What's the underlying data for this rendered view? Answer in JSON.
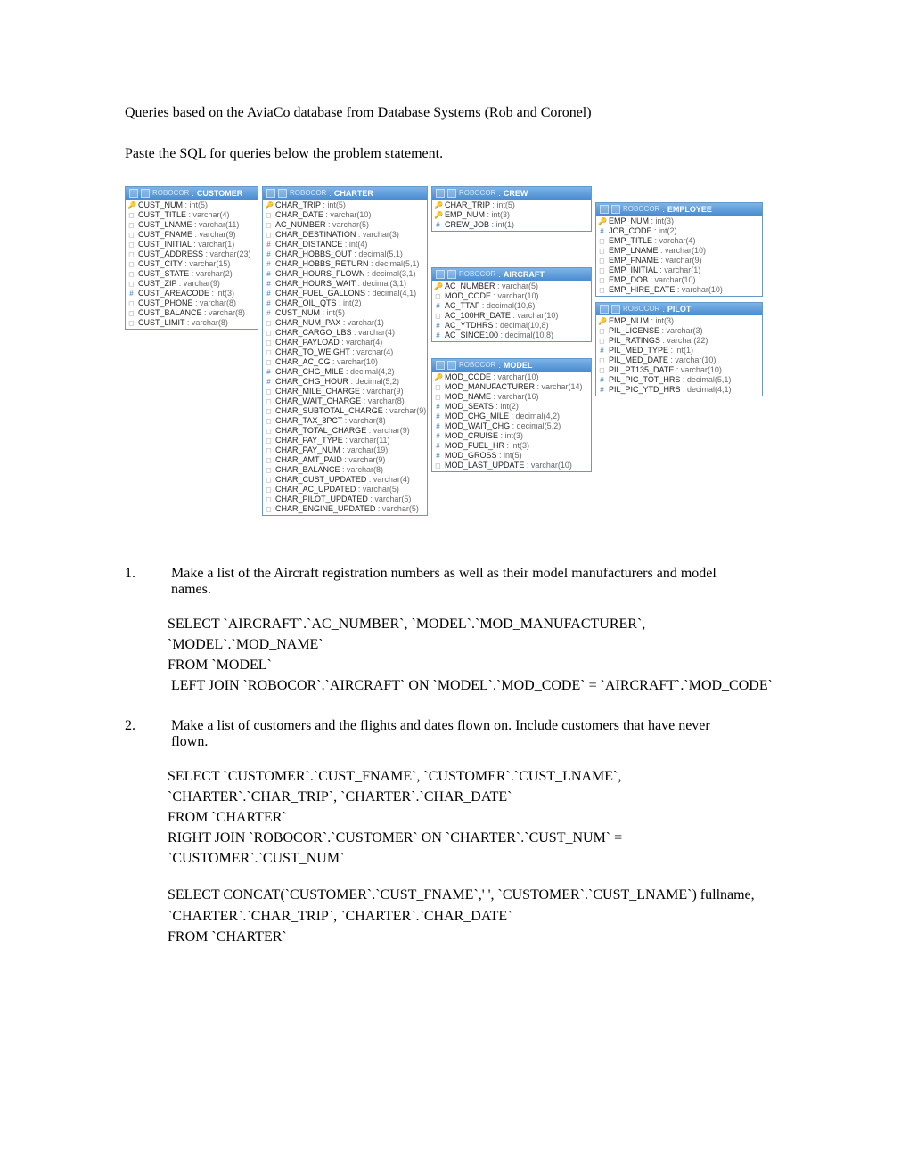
{
  "intro_line1": "Queries based on the AviaCo database from Database Systems (Rob and Coronel)",
  "intro_line2": "Paste the SQL for queries below the problem statement.",
  "schema": "ROBOCOR",
  "tables": {
    "customer": {
      "name": "CUSTOMER",
      "fields": [
        {
          "ic": "pk",
          "name": "CUST_NUM",
          "type": "int(5)"
        },
        {
          "ic": "col",
          "name": "CUST_TITLE",
          "type": "varchar(4)"
        },
        {
          "ic": "col",
          "name": "CUST_LNAME",
          "type": "varchar(11)"
        },
        {
          "ic": "col",
          "name": "CUST_FNAME",
          "type": "varchar(9)"
        },
        {
          "ic": "col",
          "name": "CUST_INITIAL",
          "type": "varchar(1)"
        },
        {
          "ic": "col",
          "name": "CUST_ADDRESS",
          "type": "varchar(23)"
        },
        {
          "ic": "col",
          "name": "CUST_CITY",
          "type": "varchar(15)"
        },
        {
          "ic": "col",
          "name": "CUST_STATE",
          "type": "varchar(2)"
        },
        {
          "ic": "col",
          "name": "CUST_ZIP",
          "type": "varchar(9)"
        },
        {
          "ic": "num",
          "name": "CUST_AREACODE",
          "type": "int(3)"
        },
        {
          "ic": "col",
          "name": "CUST_PHONE",
          "type": "varchar(8)"
        },
        {
          "ic": "col",
          "name": "CUST_BALANCE",
          "type": "varchar(8)"
        },
        {
          "ic": "col",
          "name": "CUST_LIMIT",
          "type": "varchar(8)"
        }
      ]
    },
    "charter": {
      "name": "CHARTER",
      "fields": [
        {
          "ic": "pk",
          "name": "CHAR_TRIP",
          "type": "int(5)"
        },
        {
          "ic": "col",
          "name": "CHAR_DATE",
          "type": "varchar(10)"
        },
        {
          "ic": "col",
          "name": "AC_NUMBER",
          "type": "varchar(5)"
        },
        {
          "ic": "col",
          "name": "CHAR_DESTINATION",
          "type": "varchar(3)"
        },
        {
          "ic": "num",
          "name": "CHAR_DISTANCE",
          "type": "int(4)"
        },
        {
          "ic": "num",
          "name": "CHAR_HOBBS_OUT",
          "type": "decimal(5,1)"
        },
        {
          "ic": "num",
          "name": "CHAR_HOBBS_RETURN",
          "type": "decimal(5,1)"
        },
        {
          "ic": "num",
          "name": "CHAR_HOURS_FLOWN",
          "type": "decimal(3,1)"
        },
        {
          "ic": "num",
          "name": "CHAR_HOURS_WAIT",
          "type": "decimal(3,1)"
        },
        {
          "ic": "num",
          "name": "CHAR_FUEL_GALLONS",
          "type": "decimal(4,1)"
        },
        {
          "ic": "num",
          "name": "CHAR_OIL_QTS",
          "type": "int(2)"
        },
        {
          "ic": "num",
          "name": "CUST_NUM",
          "type": "int(5)"
        },
        {
          "ic": "col",
          "name": "CHAR_NUM_PAX",
          "type": "varchar(1)"
        },
        {
          "ic": "col",
          "name": "CHAR_CARGO_LBS",
          "type": "varchar(4)"
        },
        {
          "ic": "col",
          "name": "CHAR_PAYLOAD",
          "type": "varchar(4)"
        },
        {
          "ic": "col",
          "name": "CHAR_TO_WEIGHT",
          "type": "varchar(4)"
        },
        {
          "ic": "col",
          "name": "CHAR_AC_CG",
          "type": "varchar(10)"
        },
        {
          "ic": "num",
          "name": "CHAR_CHG_MILE",
          "type": "decimal(4,2)"
        },
        {
          "ic": "num",
          "name": "CHAR_CHG_HOUR",
          "type": "decimal(5,2)"
        },
        {
          "ic": "col",
          "name": "CHAR_MILE_CHARGE",
          "type": "varchar(9)"
        },
        {
          "ic": "col",
          "name": "CHAR_WAIT_CHARGE",
          "type": "varchar(8)"
        },
        {
          "ic": "col",
          "name": "CHAR_SUBTOTAL_CHARGE",
          "type": "varchar(9)"
        },
        {
          "ic": "col",
          "name": "CHAR_TAX_8PCT",
          "type": "varchar(8)"
        },
        {
          "ic": "col",
          "name": "CHAR_TOTAL_CHARGE",
          "type": "varchar(9)"
        },
        {
          "ic": "col",
          "name": "CHAR_PAY_TYPE",
          "type": "varchar(11)"
        },
        {
          "ic": "col",
          "name": "CHAR_PAY_NUM",
          "type": "varchar(19)"
        },
        {
          "ic": "col",
          "name": "CHAR_AMT_PAID",
          "type": "varchar(9)"
        },
        {
          "ic": "col",
          "name": "CHAR_BALANCE",
          "type": "varchar(8)"
        },
        {
          "ic": "col",
          "name": "CHAR_CUST_UPDATED",
          "type": "varchar(4)"
        },
        {
          "ic": "col",
          "name": "CHAR_AC_UPDATED",
          "type": "varchar(5)"
        },
        {
          "ic": "col",
          "name": "CHAR_PILOT_UPDATED",
          "type": "varchar(5)"
        },
        {
          "ic": "col",
          "name": "CHAR_ENGINE_UPDATED",
          "type": "varchar(5)"
        }
      ]
    },
    "crew": {
      "name": "CREW",
      "fields": [
        {
          "ic": "pk",
          "name": "CHAR_TRIP",
          "type": "int(5)"
        },
        {
          "ic": "pk",
          "name": "EMP_NUM",
          "type": "int(3)"
        },
        {
          "ic": "num",
          "name": "CREW_JOB",
          "type": "int(1)"
        }
      ]
    },
    "aircraft": {
      "name": "AIRCRAFT",
      "fields": [
        {
          "ic": "pk",
          "name": "AC_NUMBER",
          "type": "varchar(5)"
        },
        {
          "ic": "col",
          "name": "MOD_CODE",
          "type": "varchar(10)"
        },
        {
          "ic": "num",
          "name": "AC_TTAF",
          "type": "decimal(10,6)"
        },
        {
          "ic": "col",
          "name": "AC_100HR_DATE",
          "type": "varchar(10)"
        },
        {
          "ic": "num",
          "name": "AC_YTDHRS",
          "type": "decimal(10,8)"
        },
        {
          "ic": "num",
          "name": "AC_SINCE100",
          "type": "decimal(10,8)"
        }
      ]
    },
    "model": {
      "name": "MODEL",
      "fields": [
        {
          "ic": "pk",
          "name": "MOD_CODE",
          "type": "varchar(10)"
        },
        {
          "ic": "col",
          "name": "MOD_MANUFACTURER",
          "type": "varchar(14)"
        },
        {
          "ic": "col",
          "name": "MOD_NAME",
          "type": "varchar(16)"
        },
        {
          "ic": "num",
          "name": "MOD_SEATS",
          "type": "int(2)"
        },
        {
          "ic": "num",
          "name": "MOD_CHG_MILE",
          "type": "decimal(4,2)"
        },
        {
          "ic": "num",
          "name": "MOD_WAIT_CHG",
          "type": "decimal(5,2)"
        },
        {
          "ic": "num",
          "name": "MOD_CRUISE",
          "type": "int(3)"
        },
        {
          "ic": "num",
          "name": "MOD_FUEL_HR",
          "type": "int(3)"
        },
        {
          "ic": "num",
          "name": "MOD_GROSS",
          "type": "int(5)"
        },
        {
          "ic": "col",
          "name": "MOD_LAST_UPDATE",
          "type": "varchar(10)"
        }
      ]
    },
    "employee": {
      "name": "EMPLOYEE",
      "fields": [
        {
          "ic": "pk",
          "name": "EMP_NUM",
          "type": "int(3)"
        },
        {
          "ic": "num",
          "name": "JOB_CODE",
          "type": "int(2)"
        },
        {
          "ic": "col",
          "name": "EMP_TITLE",
          "type": "varchar(4)"
        },
        {
          "ic": "col",
          "name": "EMP_LNAME",
          "type": "varchar(10)"
        },
        {
          "ic": "col",
          "name": "EMP_FNAME",
          "type": "varchar(9)"
        },
        {
          "ic": "col",
          "name": "EMP_INITIAL",
          "type": "varchar(1)"
        },
        {
          "ic": "col",
          "name": "EMP_DOB",
          "type": "varchar(10)"
        },
        {
          "ic": "col",
          "name": "EMP_HIRE_DATE",
          "type": "varchar(10)"
        }
      ]
    },
    "pilot": {
      "name": "PILOT",
      "fields": [
        {
          "ic": "pk",
          "name": "EMP_NUM",
          "type": "int(3)"
        },
        {
          "ic": "col",
          "name": "PIL_LICENSE",
          "type": "varchar(3)"
        },
        {
          "ic": "col",
          "name": "PIL_RATINGS",
          "type": "varchar(22)"
        },
        {
          "ic": "num",
          "name": "PIL_MED_TYPE",
          "type": "int(1)"
        },
        {
          "ic": "col",
          "name": "PIL_MED_DATE",
          "type": "varchar(10)"
        },
        {
          "ic": "col",
          "name": "PIL_PT135_DATE",
          "type": "varchar(10)"
        },
        {
          "ic": "num",
          "name": "PIL_PIC_TOT_HRS",
          "type": "decimal(5,1)"
        },
        {
          "ic": "num",
          "name": "PIL_PIC_YTD_HRS",
          "type": "decimal(4,1)"
        }
      ]
    }
  },
  "q1": {
    "num": "1.",
    "text": "Make a list of the Aircraft registration numbers as well as their model manufacturers and model names.",
    "sql": "SELECT `AIRCRAFT`.`AC_NUMBER`, `MODEL`.`MOD_MANUFACTURER`, `MODEL`.`MOD_NAME`\nFROM `MODEL`\n LEFT JOIN `ROBOCOR`.`AIRCRAFT` ON `MODEL`.`MOD_CODE` = `AIRCRAFT`.`MOD_CODE`"
  },
  "q2": {
    "num": "2.",
    "text": "Make a list of customers and the flights and dates flown on.  Include customers that have never flown.",
    "sql1": "SELECT `CUSTOMER`.`CUST_FNAME`, `CUSTOMER`.`CUST_LNAME`, `CHARTER`.`CHAR_TRIP`, `CHARTER`.`CHAR_DATE`\nFROM `CHARTER`\nRIGHT JOIN `ROBOCOR`.`CUSTOMER` ON `CHARTER`.`CUST_NUM` = `CUSTOMER`.`CUST_NUM`",
    "sql2": "SELECT CONCAT(`CUSTOMER`.`CUST_FNAME`,' ', `CUSTOMER`.`CUST_LNAME`) fullname, `CHARTER`.`CHAR_TRIP`, `CHARTER`.`CHAR_DATE`\nFROM `CHARTER`"
  }
}
